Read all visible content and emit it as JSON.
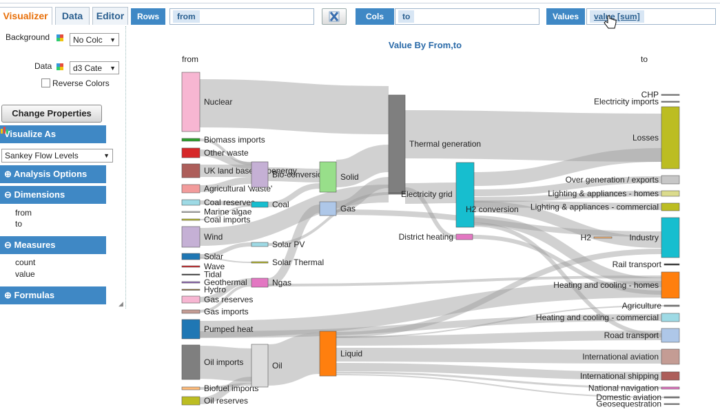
{
  "tabs": [
    {
      "label": "Visualizer",
      "active": true
    },
    {
      "label": "Data",
      "active": false
    },
    {
      "label": "Editor",
      "active": false
    }
  ],
  "shelves": {
    "rows": {
      "label": "Rows",
      "value": "from"
    },
    "cols": {
      "label": "Cols",
      "value": "to"
    },
    "values": {
      "label": "Values",
      "value": "value [sum]"
    }
  },
  "left_panel": {
    "background_label": "Background",
    "background_value": "No Colc",
    "data_label": "Data",
    "data_value": "d3 Cate",
    "reverse_colors_label": "Reverse Colors",
    "reverse_colors_checked": false,
    "change_properties_label": "Change Properties",
    "visualize_as_label": "Visualize As",
    "visualize_as_value": "Sankey Flow Levels",
    "analysis_options_label": "Analysis Options",
    "dimensions_label": "Dimensions",
    "dimensions": [
      "from",
      "to"
    ],
    "measures_label": "Measures",
    "measures": [
      "count",
      "value"
    ],
    "formulas_label": "Formulas"
  },
  "chart_data": {
    "type": "sankey",
    "title": "Value By From,to",
    "left_header": "from",
    "right_header": "to",
    "nodes": [
      {
        "label": "Nuclear",
        "color": "#f7b6d2"
      },
      {
        "label": "Biomass imports",
        "color": "#2ca02c"
      },
      {
        "label": "Other waste",
        "color": "#d62728"
      },
      {
        "label": "UK land based bioenergy",
        "color": "#ad5e5a"
      },
      {
        "label": "Agricultural 'waste'",
        "color": "#f29b9b"
      },
      {
        "label": "Coal reserves",
        "color": "#9edae5"
      },
      {
        "label": "Marine algae",
        "color": "#c7c7c7"
      },
      {
        "label": "Coal imports",
        "color": "#bcbd22"
      },
      {
        "label": "Wind",
        "color": "#c5b0d5"
      },
      {
        "label": "Solar",
        "color": "#1f77b4"
      },
      {
        "label": "Wave",
        "color": "#d62728"
      },
      {
        "label": "Tidal",
        "color": "#333333"
      },
      {
        "label": "Geothermal",
        "color": "#9467bd"
      },
      {
        "label": "Hydro",
        "color": "#8c6d31"
      },
      {
        "label": "Gas reserves",
        "color": "#f7b6d2"
      },
      {
        "label": "Gas imports",
        "color": "#c49c94"
      },
      {
        "label": "Pumped heat",
        "color": "#1f77b4"
      },
      {
        "label": "Oil imports",
        "color": "#7f7f7f"
      },
      {
        "label": "Biofuel imports",
        "color": "#ffbb78"
      },
      {
        "label": "Oil reserves",
        "color": "#bcbd22"
      },
      {
        "label": "Bio-conversion",
        "color": "#c5b0d5"
      },
      {
        "label": "Coal",
        "color": "#17becf"
      },
      {
        "label": "Solar PV",
        "color": "#9edae5"
      },
      {
        "label": "Solar Thermal",
        "color": "#bcbd22"
      },
      {
        "label": "Ngas",
        "color": "#e377c2"
      },
      {
        "label": "Oil",
        "color": "#dddddd"
      },
      {
        "label": "Solid",
        "color": "#98df8a"
      },
      {
        "label": "Gas",
        "color": "#aec7e8"
      },
      {
        "label": "Liquid",
        "color": "#ff7f0e"
      },
      {
        "label": "Thermal generation",
        "color": "#7f7f7f"
      },
      {
        "label": "Electricity grid",
        "color": "#7f7f7f"
      },
      {
        "label": "District heating",
        "color": "#e377c2"
      },
      {
        "label": "H2 conversion",
        "color": "#17becf"
      },
      {
        "label": "H2",
        "color": "#ffbb78"
      },
      {
        "label": "CHP",
        "color": "#7f7f7f"
      },
      {
        "label": "Electricity imports",
        "color": "#7f7f7f"
      },
      {
        "label": "Losses",
        "color": "#bcbd22"
      },
      {
        "label": "Over generation / exports",
        "color": "#c7c7c7"
      },
      {
        "label": "Lighting & appliances - homes",
        "color": "#dbdb8d"
      },
      {
        "label": "Lighting & appliances - commercial",
        "color": "#bcbd22"
      },
      {
        "label": "Industry",
        "color": "#17becf"
      },
      {
        "label": "Rail transport",
        "color": "#333333"
      },
      {
        "label": "Heating and cooling - homes",
        "color": "#ff7f0e"
      },
      {
        "label": "Agriculture",
        "color": "#7f7f7f"
      },
      {
        "label": "Heating and cooling - commercial",
        "color": "#9edae5"
      },
      {
        "label": "Road transport",
        "color": "#aec7e8"
      },
      {
        "label": "International aviation",
        "color": "#c49c94"
      },
      {
        "label": "International shipping",
        "color": "#ad5e5a"
      },
      {
        "label": "National navigation",
        "color": "#e377c2"
      },
      {
        "label": "Domestic aviation",
        "color": "#7f7f7f"
      },
      {
        "label": "Geosequestration",
        "color": "#7f7f7f"
      }
    ]
  }
}
